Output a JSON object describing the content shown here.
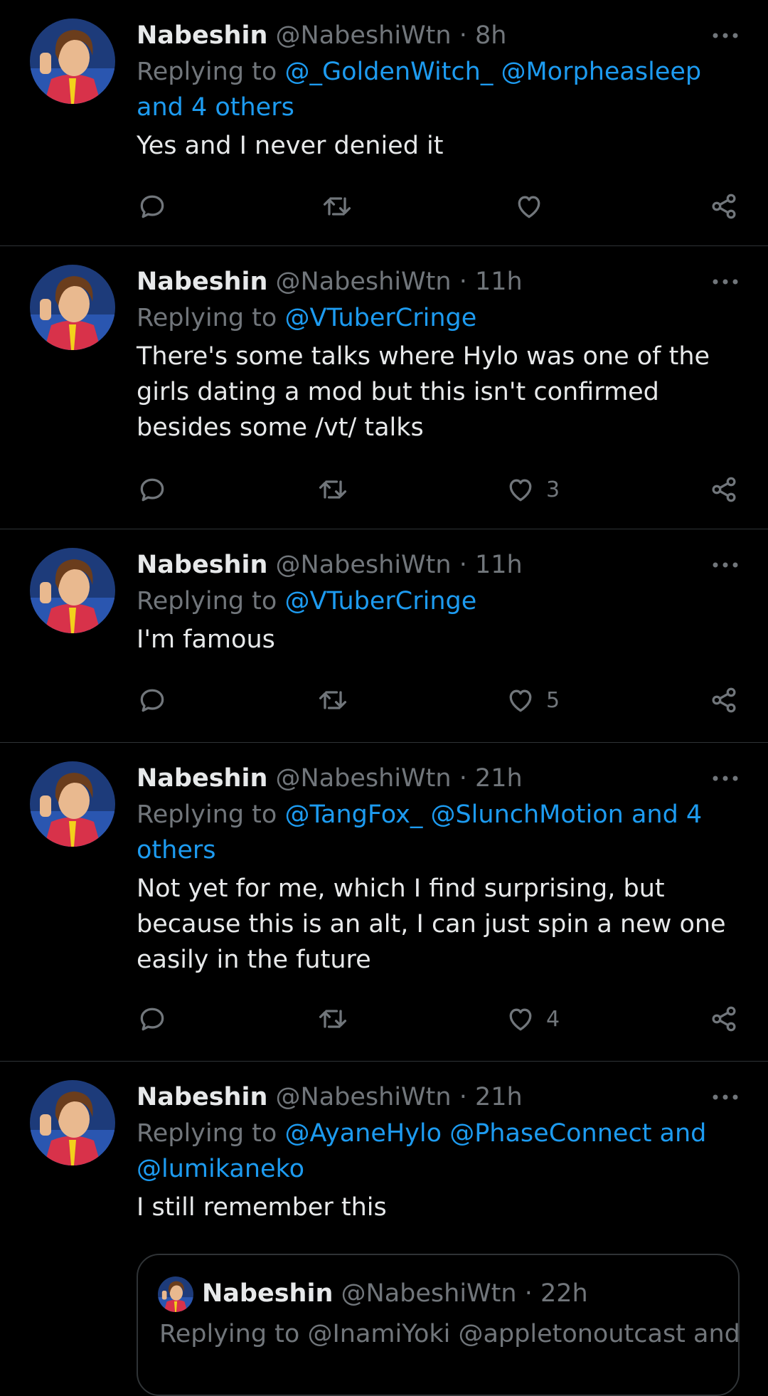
{
  "tweets": [
    {
      "name": "Nabeshin",
      "handle": "@NabeshiWtn",
      "time": "· 8h",
      "replying_prefix": "Replying to ",
      "replying_mentions": "@_GoldenWitch_ @Morpheasleep and 4 others",
      "text": "Yes and I never denied it",
      "likes": ""
    },
    {
      "name": "Nabeshin",
      "handle": "@NabeshiWtn",
      "time": "· 11h",
      "replying_prefix": "Replying to ",
      "replying_mentions": "@VTuberCringe",
      "text": "There's some talks where Hylo was one of the girls dating a mod but this isn't confirmed besides some /vt/ talks",
      "likes": "3"
    },
    {
      "name": "Nabeshin",
      "handle": "@NabeshiWtn",
      "time": "· 11h",
      "replying_prefix": "Replying to ",
      "replying_mentions": "@VTuberCringe",
      "text": "I'm famous",
      "likes": "5"
    },
    {
      "name": "Nabeshin",
      "handle": "@NabeshiWtn",
      "time": "· 21h",
      "replying_prefix": "Replying to ",
      "replying_mentions": "@TangFox_ @SlunchMotion and 4 others",
      "text": "Not yet for me, which I find surprising, but because this is an alt, I can just spin a new one easily in the future",
      "likes": "4"
    },
    {
      "name": "Nabeshin",
      "handle": "@NabeshiWtn",
      "time": "· 21h",
      "replying_prefix": "Replying to ",
      "replying_mentions": "@AyaneHylo @PhaseConnect and @lumikaneko",
      "text": "I still remember this",
      "likes": ""
    }
  ],
  "quote": {
    "name": "Nabeshin",
    "handle": "@NabeshiWtn",
    "time": "· 22h",
    "replying": "Replying to @InamiYoki @appletonoutcast and"
  },
  "icons": {
    "more": "more-horizontal-icon",
    "reply": "reply-bubble-icon",
    "retweet": "retweet-icon",
    "like": "heart-icon",
    "share": "share-nodes-icon"
  },
  "colors": {
    "background": "#000000",
    "text": "#e7e9ea",
    "secondary": "#71767b",
    "accent": "#1d9bf0",
    "divider": "#2f3336"
  }
}
